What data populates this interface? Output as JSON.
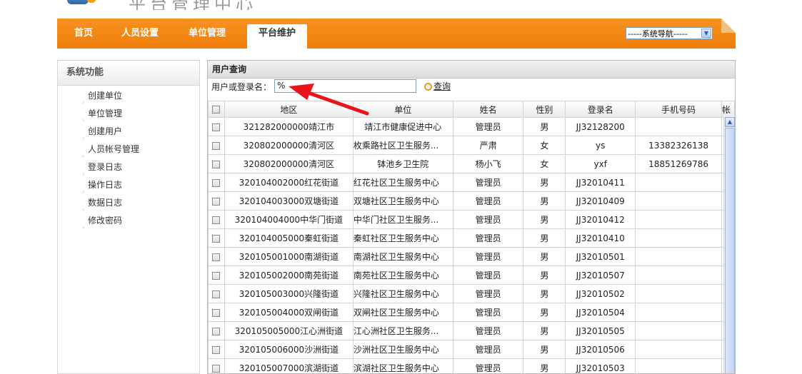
{
  "header": {
    "title": "平台管理中心"
  },
  "nav": {
    "items": [
      "首页",
      "人员设置",
      "单位管理",
      "平台维护"
    ],
    "active": "平台维护",
    "select_value": "-----系统导航-----"
  },
  "sidebar": {
    "title": "系统功能",
    "items": [
      "创建单位",
      "单位管理",
      "创建用户",
      "人员帐号管理",
      "登录日志",
      "操作日志",
      "数据日志",
      "修改密码"
    ]
  },
  "panel": {
    "title": "用户查询",
    "search_label": "用户或登录名：",
    "search_value": "%",
    "search_button": "查询"
  },
  "table": {
    "headers": [
      "地区",
      "单位",
      "姓名",
      "性别",
      "登录名",
      "手机号码",
      "帐"
    ],
    "rows": [
      [
        "321282000000靖江市",
        "靖江市健康促进中心",
        "管理员",
        "男",
        "JJ32128200",
        ""
      ],
      [
        "320802000000清河区",
        "枚乘路社区卫生服务...",
        "严肃",
        "女",
        "ys",
        "13382326138"
      ],
      [
        "320802000000清河区",
        "钵池乡卫生院",
        "杨小飞",
        "女",
        "yxf",
        "18851269786"
      ],
      [
        "320104002000红花街道",
        "红花社区卫生服务中心",
        "管理员",
        "男",
        "JJ32010411",
        ""
      ],
      [
        "320104003000双塘街道",
        "双塘社区卫生服务中心",
        "管理员",
        "男",
        "JJ32010409",
        ""
      ],
      [
        "320104004000中华门街道",
        "中华门社区卫生服务...",
        "管理员",
        "男",
        "JJ32010412",
        ""
      ],
      [
        "320104005000秦虹街道",
        "秦虹社区卫生服务中心",
        "管理员",
        "男",
        "JJ32010410",
        ""
      ],
      [
        "320105001000南湖街道",
        "南湖社区卫生服务中心",
        "管理员",
        "男",
        "JJ32010501",
        ""
      ],
      [
        "320105002000南苑街道",
        "南苑社区卫生服务中心",
        "管理员",
        "男",
        "JJ32010507",
        ""
      ],
      [
        "320105003000兴隆街道",
        "兴隆社区卫生服务中心",
        "管理员",
        "男",
        "JJ32010502",
        ""
      ],
      [
        "320105004000双闸街道",
        "双闸社区卫生服务中心",
        "管理员",
        "男",
        "JJ32010504",
        ""
      ],
      [
        "320105005000江心洲街道",
        "江心洲社区卫生服务...",
        "管理员",
        "男",
        "JJ32010505",
        ""
      ],
      [
        "320105006000沙洲街道",
        "沙洲社区卫生服务中心",
        "管理员",
        "男",
        "JJ32010506",
        ""
      ],
      [
        "320105007000滨湖街道",
        "滨湖社区卫生服务中心",
        "管理员",
        "男",
        "JJ32010503",
        ""
      ]
    ]
  },
  "colors": {
    "nav_orange": "#f08a12",
    "annotation_red": "#e8141a"
  }
}
